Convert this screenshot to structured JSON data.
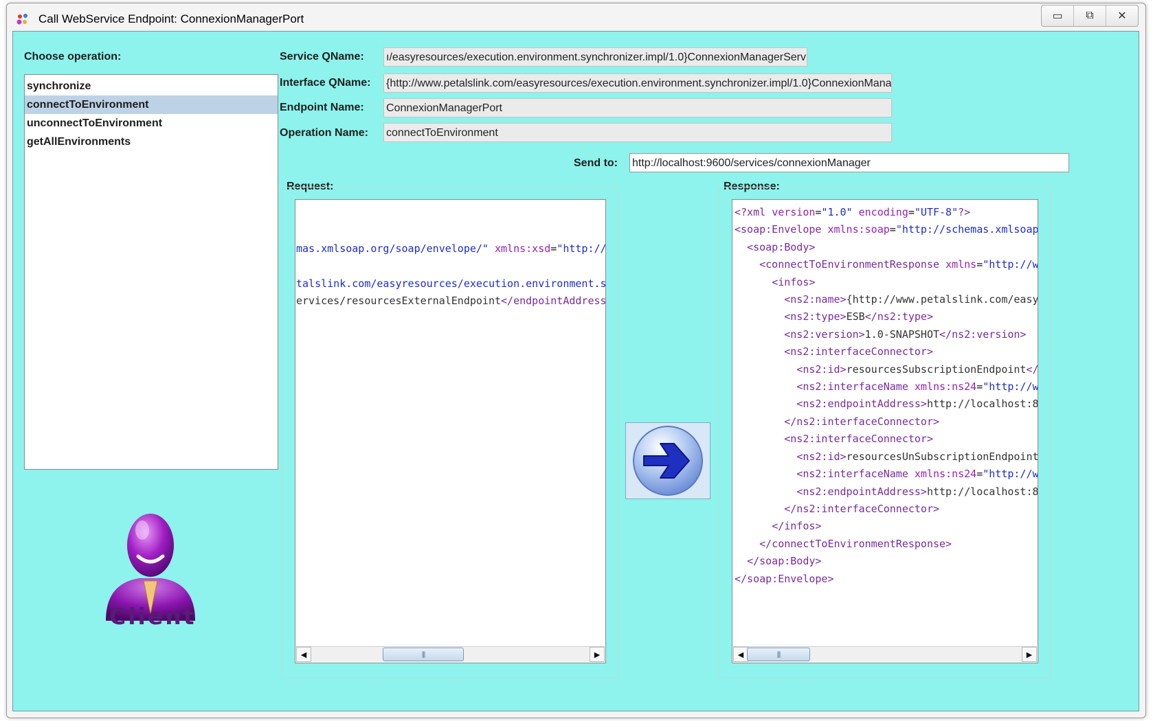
{
  "window": {
    "title": "Call WebService Endpoint: ConnexionManagerPort",
    "controls": [
      "minimize",
      "maximize",
      "close"
    ]
  },
  "operations": {
    "label": "Choose operation:",
    "items": [
      "synchronize",
      "connectToEnvironment",
      "unconnectToEnvironment",
      "getAllEnvironments"
    ],
    "selected": "connectToEnvironment"
  },
  "form": {
    "service_qname_label": "Service QName:",
    "service_qname_value": "ı/easyresources/execution.environment.synchronizer.impl/1.0}ConnexionManagerService",
    "interface_qname_label": "Interface QName:",
    "interface_qname_value": "{http://www.petalslink.com/easyresources/execution.environment.synchronizer.impl/1.0}ConnexionManager",
    "endpoint_name_label": "Endpoint Name:",
    "endpoint_name_value": "ConnexionManagerPort",
    "operation_name_label": "Operation Name:",
    "operation_name_value": "connectToEnvironment",
    "send_to_label": "Send to:",
    "send_to_value": "http://localhost:9600/services/connexionManager"
  },
  "request": {
    "label": "Request:"
  },
  "response": {
    "label": "Response:"
  },
  "client_logo": {
    "text": "Client"
  },
  "icons": {
    "app": "app-icon",
    "send": "arrow-right-icon",
    "client": "client-person-icon"
  },
  "colors": {
    "background": "#8df3ec",
    "selection": "#bdd2e6",
    "xml_tag": "#7a2aa0",
    "xml_attr": "#9a1fb5",
    "xml_value": "#1d2bd6"
  }
}
